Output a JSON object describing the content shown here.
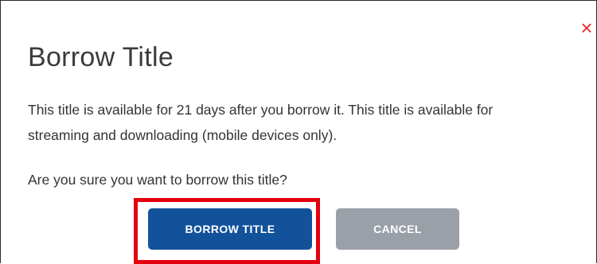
{
  "dialog": {
    "title": "Borrow Title",
    "close_icon": "close-icon",
    "description": "This title is available for 21 days after you borrow it. This title is available for streaming and downloading (mobile devices only).",
    "question": "Are you sure you want to borrow this title?",
    "buttons": {
      "borrow_label": "BORROW TITLE",
      "cancel_label": "CANCEL"
    }
  },
  "colors": {
    "primary_button": "#12529b",
    "secondary_button": "#9aa0a8",
    "close_icon": "#e03131",
    "highlight_outline": "#e3000f"
  }
}
